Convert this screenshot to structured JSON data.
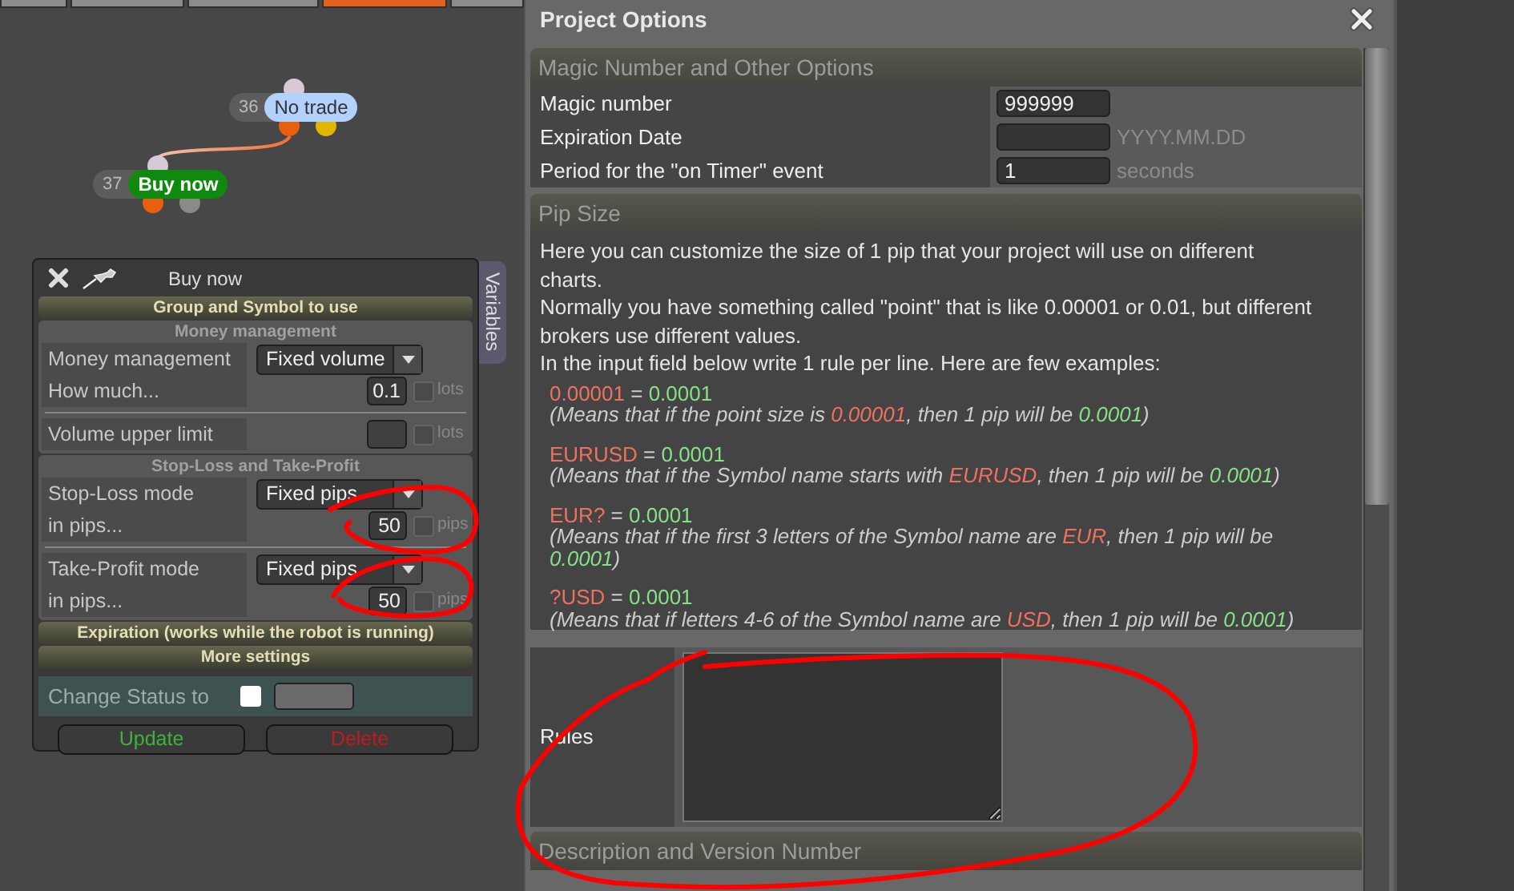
{
  "top_tabs": [
    {
      "selected": false
    },
    {
      "selected": false
    },
    {
      "selected": false
    },
    {
      "selected": true
    },
    {
      "selected": false
    }
  ],
  "canvas": {
    "nodes": [
      {
        "number": "36",
        "label": "No trade",
        "color": "#b3d1ff",
        "outputs": [
          {
            "color": "#e8600c"
          },
          {
            "color": "#e2b600"
          }
        ]
      },
      {
        "number": "37",
        "label": "Buy now",
        "color": "#0f8a0f",
        "outputs": [
          {
            "color": "#e8600c"
          },
          {
            "color": "#8a8a8a"
          }
        ]
      }
    ]
  },
  "block_panel": {
    "title": "Buy now",
    "side_tab": "Variables",
    "sections": [
      {
        "kind": "header",
        "title": "Group and Symbol to use"
      },
      {
        "kind": "group",
        "title": "Money management",
        "rows": [
          {
            "kind": "select",
            "label": "Money management",
            "value": "Fixed volume"
          },
          {
            "kind": "number",
            "label": "How much...",
            "value": "0.1",
            "unit": "lots",
            "checked": false
          },
          {
            "kind": "divider"
          },
          {
            "kind": "number",
            "label": "Volume upper limit",
            "unit": "lots",
            "checked": false
          }
        ]
      },
      {
        "kind": "group",
        "title": "Stop-Loss and Take-Profit",
        "rows": [
          {
            "kind": "select",
            "label": "Stop-Loss mode",
            "value": "Fixed pips"
          },
          {
            "kind": "number",
            "label": "in pips...",
            "value": "50",
            "unit": "pips",
            "checked": false
          },
          {
            "kind": "divider"
          },
          {
            "kind": "select",
            "label": "Take-Profit mode",
            "value": "Fixed pips"
          },
          {
            "kind": "number",
            "label": "in pips...",
            "value": "50",
            "unit": "pips",
            "checked": false
          }
        ]
      },
      {
        "kind": "header",
        "title": "Expiration (works while the robot is running)"
      },
      {
        "kind": "header",
        "title": "More settings"
      }
    ],
    "status": {
      "label": "Change Status to",
      "checked": false
    },
    "buttons": [
      {
        "label": "Update",
        "kind": "confirm"
      },
      {
        "label": "Delete",
        "kind": "danger"
      }
    ]
  },
  "project_options": {
    "title": "Project Options",
    "magic_section": {
      "title": "Magic Number and Other Options",
      "fields": [
        {
          "label": "Magic number",
          "value": "999999"
        },
        {
          "label": "Expiration Date",
          "unit": "YYYY.MM.DD"
        },
        {
          "label": "Period for the \"on Timer\" event",
          "value": "1",
          "unit": "seconds"
        }
      ]
    },
    "pip_section": {
      "title": "Pip Size",
      "intro": [
        "Here you can customize the size of 1 pip that your project will use on different charts.",
        "Normally you have something called \"point\" that is like 0.00001 or 0.01, but different brokers use different values.",
        "In the input field below write 1 rule per line. Here are few examples:"
      ],
      "examples": [
        {
          "rule": [
            {
              "kind": "pattern",
              "text": "0.00001"
            },
            {
              "kind": "plain",
              "text": " = "
            },
            {
              "kind": "value",
              "text": "0.0001"
            }
          ],
          "note": [
            {
              "kind": "plain",
              "text": "(Means that if the point size is "
            },
            {
              "kind": "pattern",
              "text": "0.00001"
            },
            {
              "kind": "plain",
              "text": ", then 1 pip will be "
            },
            {
              "kind": "value",
              "text": "0.0001"
            },
            {
              "kind": "plain",
              "text": ")"
            }
          ]
        },
        {
          "rule": [
            {
              "kind": "pattern",
              "text": "EURUSD"
            },
            {
              "kind": "plain",
              "text": " = "
            },
            {
              "kind": "value",
              "text": "0.0001"
            }
          ],
          "note": [
            {
              "kind": "plain",
              "text": "(Means that if the Symbol name starts with "
            },
            {
              "kind": "pattern",
              "text": "EURUSD"
            },
            {
              "kind": "plain",
              "text": ", then 1 pip will be "
            },
            {
              "kind": "value",
              "text": "0.0001"
            },
            {
              "kind": "plain",
              "text": ")"
            }
          ]
        },
        {
          "rule": [
            {
              "kind": "pattern",
              "text": "EUR?"
            },
            {
              "kind": "plain",
              "text": " = "
            },
            {
              "kind": "value",
              "text": "0.0001"
            }
          ],
          "note": [
            {
              "kind": "plain",
              "text": "(Means that if the first 3 letters of the Symbol name are "
            },
            {
              "kind": "pattern",
              "text": "EUR"
            },
            {
              "kind": "plain",
              "text": ", then 1 pip will be "
            },
            {
              "kind": "value",
              "text": "0.0001"
            },
            {
              "kind": "plain",
              "text": ")"
            }
          ]
        },
        {
          "rule": [
            {
              "kind": "pattern",
              "text": "?USD"
            },
            {
              "kind": "plain",
              "text": " = "
            },
            {
              "kind": "value",
              "text": "0.0001"
            }
          ],
          "note": [
            {
              "kind": "plain",
              "text": "(Means that if letters 4-6 of the Symbol name are "
            },
            {
              "kind": "pattern",
              "text": "USD"
            },
            {
              "kind": "plain",
              "text": ", then 1 pip will be "
            },
            {
              "kind": "value",
              "text": "0.0001"
            },
            {
              "kind": "plain",
              "text": ")"
            }
          ]
        }
      ],
      "rules_label": "Rules"
    },
    "description_section": {
      "title": "Description and Version Number"
    }
  },
  "annotation_marks": [
    {
      "kind": "loop"
    },
    {
      "kind": "loop"
    },
    {
      "kind": "loop"
    }
  ]
}
